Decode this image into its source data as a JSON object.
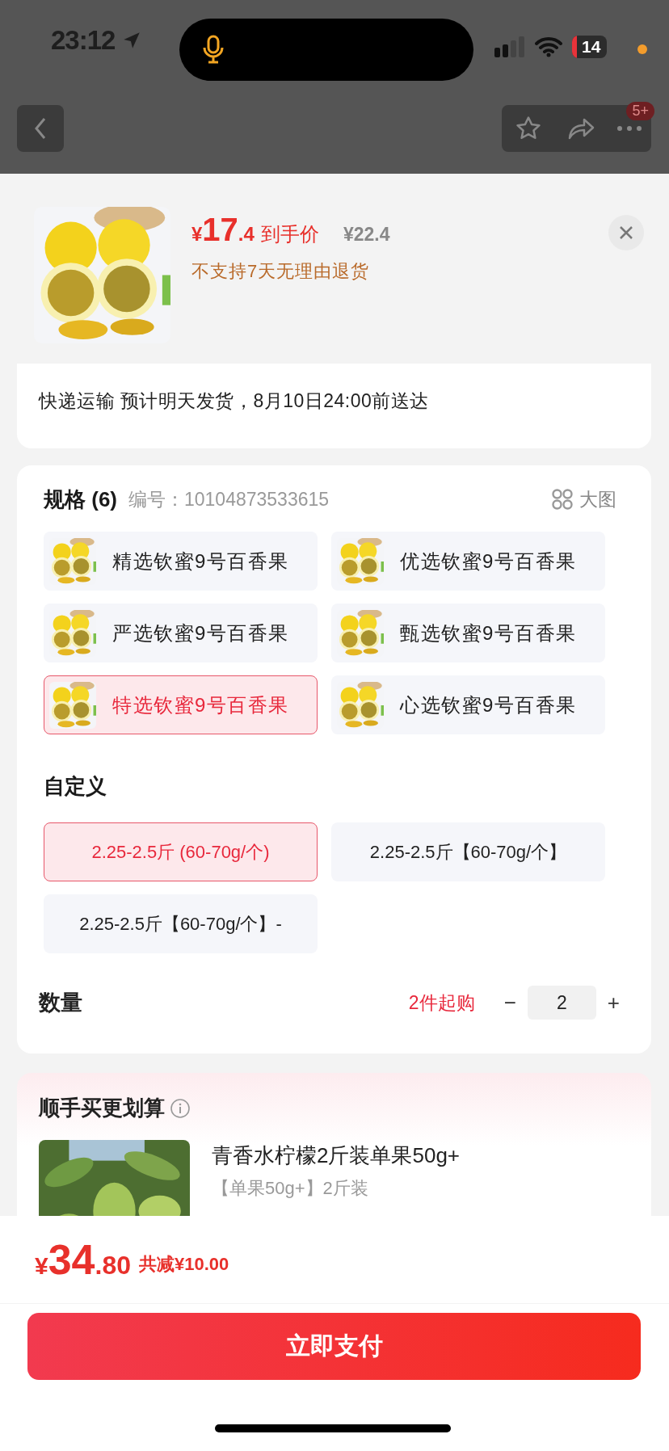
{
  "status_bar": {
    "time": "23:12",
    "battery": "14"
  },
  "nav": {
    "badge": "5+"
  },
  "product": {
    "currency": "¥",
    "price_integer": "17",
    "price_decimal": ".4",
    "price_label": "到手价",
    "original_price": "¥22.4",
    "notice": "不支持7天无理由退货"
  },
  "delivery": {
    "text": "快递运输 预计明天发货，8月10日24:00前送达"
  },
  "specs": {
    "title": "规格 (6)",
    "code": "编号：10104873533615",
    "big_image": "大图",
    "options": [
      {
        "label": "精选钦蜜9号百香果",
        "selected": false
      },
      {
        "label": "优选钦蜜9号百香果",
        "selected": false
      },
      {
        "label": "严选钦蜜9号百香果",
        "selected": false
      },
      {
        "label": "甄选钦蜜9号百香果",
        "selected": false
      },
      {
        "label": "特选钦蜜9号百香果",
        "selected": true
      },
      {
        "label": "心选钦蜜9号百香果",
        "selected": false
      }
    ]
  },
  "custom": {
    "title": "自定义",
    "options": [
      {
        "label": "2.25-2.5斤 (60-70g/个)",
        "selected": true
      },
      {
        "label": "2.25-2.5斤【60-70g/个】",
        "selected": false
      },
      {
        "label": "2.25-2.5斤【60-70g/个】-",
        "selected": false
      }
    ]
  },
  "quantity": {
    "label": "数量",
    "min_note": "2件起购",
    "minus": "−",
    "value": "2",
    "plus": "+"
  },
  "addon": {
    "title": "顺手买更划算",
    "items": [
      {
        "name": "青香水柠檬2斤装单果50g+",
        "variant": "【单果50g+】2斤装"
      }
    ]
  },
  "checkout": {
    "currency": "¥",
    "amount_integer": "34",
    "amount_decimal": ".80",
    "discount": "共减¥10.00",
    "pay_button": "立即支付"
  }
}
